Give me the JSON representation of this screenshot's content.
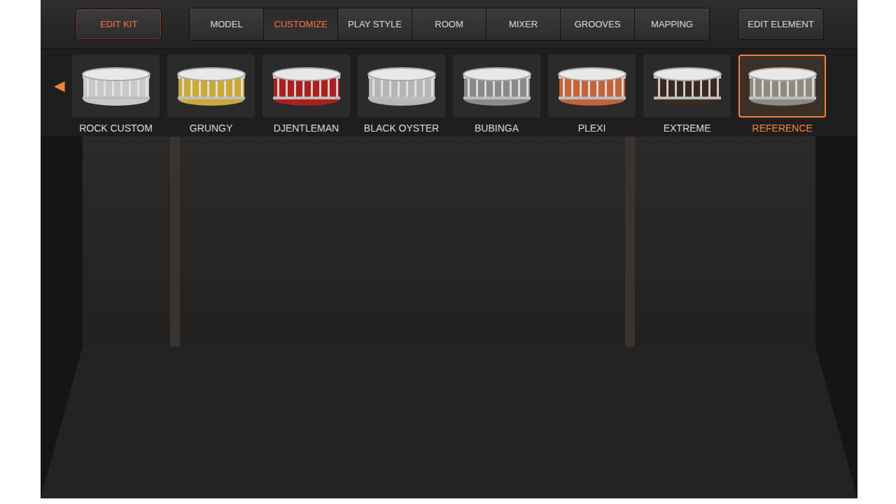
{
  "header": {
    "edit_kit": {
      "label": "EDIT KIT",
      "selected": true
    },
    "tabs": [
      {
        "label": "MODEL",
        "selected": false
      },
      {
        "label": "CUSTOMIZE",
        "selected": true
      },
      {
        "label": "PLAY STYLE",
        "selected": false
      },
      {
        "label": "ROOM",
        "selected": false
      },
      {
        "label": "MIXER",
        "selected": false
      },
      {
        "label": "GROOVES",
        "selected": false
      },
      {
        "label": "MAPPING",
        "selected": false
      }
    ],
    "edit_element": {
      "label": "EDIT ELEMENT",
      "selected": false
    }
  },
  "presets": {
    "prev_arrow": "◀",
    "items": [
      {
        "label": "ROCK CUSTOM",
        "selected": false,
        "color": "#c8c8c8"
      },
      {
        "label": "GRUNGY",
        "selected": false,
        "color": "#c9a93a"
      },
      {
        "label": "DJENTLEMAN",
        "selected": false,
        "color": "#a82020"
      },
      {
        "label": "BLACK OYSTER",
        "selected": false,
        "color": "#b5b5b5"
      },
      {
        "label": "BUBINGA",
        "selected": false,
        "color": "#8a8a8a"
      },
      {
        "label": "PLEXI",
        "selected": false,
        "color": "#c0643a"
      },
      {
        "label": "EXTREME",
        "selected": false,
        "color": "#3a2a22"
      },
      {
        "label": "REFERENCE",
        "selected": true,
        "color": "#8f8a80"
      }
    ]
  },
  "kit": {
    "snare_selected": true
  }
}
